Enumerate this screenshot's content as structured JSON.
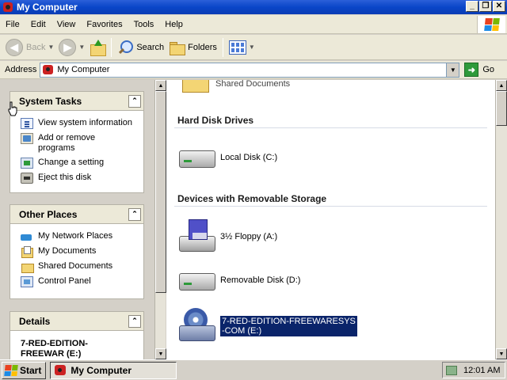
{
  "window": {
    "title": "My Computer",
    "controls": [
      "_",
      "❐",
      "✕"
    ]
  },
  "menu": [
    "File",
    "Edit",
    "View",
    "Favorites",
    "Tools",
    "Help"
  ],
  "toolbar": {
    "back": "Back",
    "search": "Search",
    "folders": "Folders"
  },
  "address": {
    "label": "Address",
    "value": "My Computer",
    "go": "Go"
  },
  "left_pane": {
    "system_tasks": {
      "title": "System Tasks",
      "items": [
        {
          "label": "View system information",
          "icon": "system-info-icon"
        },
        {
          "label": "Add or remove programs",
          "icon": "add-remove-icon"
        },
        {
          "label": "Change a setting",
          "icon": "control-setting-icon"
        },
        {
          "label": "Eject this disk",
          "icon": "eject-disk-icon"
        }
      ]
    },
    "other_places": {
      "title": "Other Places",
      "items": [
        {
          "label": "My Network Places",
          "icon": "network-icon"
        },
        {
          "label": "My Documents",
          "icon": "documents-icon"
        },
        {
          "label": "Shared Documents",
          "icon": "folder-icon"
        },
        {
          "label": "Control Panel",
          "icon": "control-panel-icon"
        }
      ]
    },
    "details": {
      "title": "Details",
      "name": "7-RED-EDITION-FREEWAR (E:)"
    }
  },
  "main": {
    "top_item": "Shared Documents",
    "hard_disk_title": "Hard Disk Drives",
    "local_disk": "Local Disk (C:)",
    "removable_title": "Devices with Removable Storage",
    "floppy": "3½ Floppy (A:)",
    "removable_disk": "Removable Disk (D:)",
    "cd_drive_line1": "7-RED-EDITION-FREEWARESYS",
    "cd_drive_line2": "-COM (E:)"
  },
  "taskbar": {
    "start": "Start",
    "task": "My Computer",
    "clock": "12:01 AM"
  }
}
